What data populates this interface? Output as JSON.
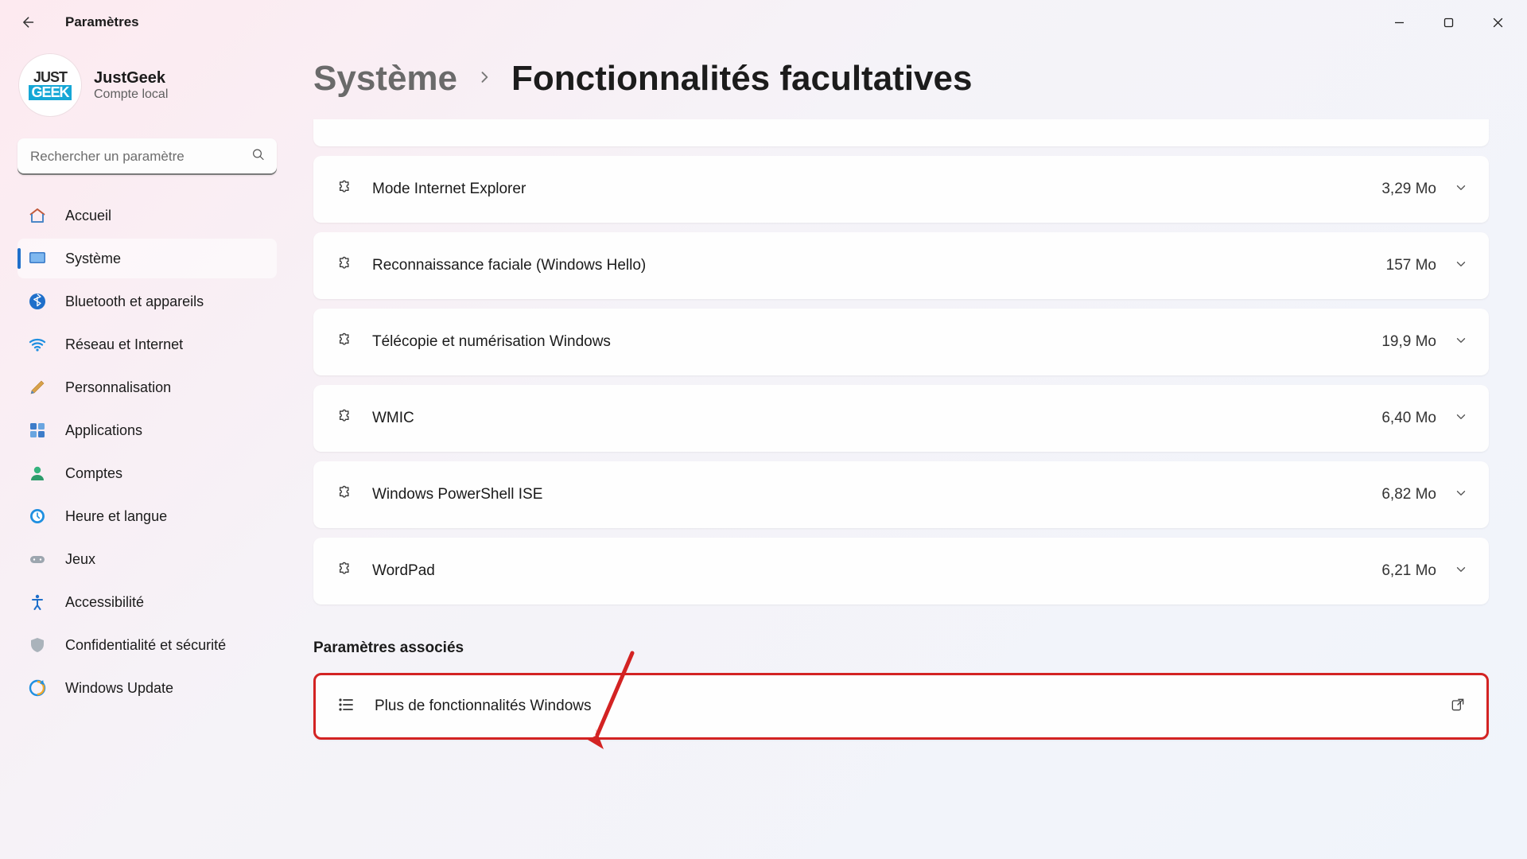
{
  "app_title": "Paramètres",
  "account": {
    "name": "JustGeek",
    "subtitle": "Compte local",
    "avatar_line1": "JUST",
    "avatar_line2": "GEEK"
  },
  "search": {
    "placeholder": "Rechercher un paramètre"
  },
  "sidebar": {
    "items": [
      {
        "key": "home",
        "label": "Accueil"
      },
      {
        "key": "system",
        "label": "Système"
      },
      {
        "key": "bluetooth",
        "label": "Bluetooth et appareils"
      },
      {
        "key": "network",
        "label": "Réseau et Internet"
      },
      {
        "key": "personalization",
        "label": "Personnalisation"
      },
      {
        "key": "apps",
        "label": "Applications"
      },
      {
        "key": "accounts",
        "label": "Comptes"
      },
      {
        "key": "time",
        "label": "Heure et langue"
      },
      {
        "key": "gaming",
        "label": "Jeux"
      },
      {
        "key": "accessibility",
        "label": "Accessibilité"
      },
      {
        "key": "privacy",
        "label": "Confidentialité et sécurité"
      },
      {
        "key": "update",
        "label": "Windows Update"
      }
    ]
  },
  "breadcrumb": {
    "parent": "Système",
    "current": "Fonctionnalités facultatives"
  },
  "features": [
    {
      "label": "Mode Internet Explorer",
      "size": "3,29 Mo"
    },
    {
      "label": "Reconnaissance faciale (Windows Hello)",
      "size": "157 Mo"
    },
    {
      "label": "Télécopie et numérisation Windows",
      "size": "19,9 Mo"
    },
    {
      "label": "WMIC",
      "size": "6,40 Mo"
    },
    {
      "label": "Windows PowerShell ISE",
      "size": "6,82 Mo"
    },
    {
      "label": "WordPad",
      "size": "6,21 Mo"
    }
  ],
  "related": {
    "heading": "Paramètres associés",
    "item_label": "Plus de fonctionnalités Windows"
  },
  "colors": {
    "accent": "#1f6fca",
    "highlight": "#d32323"
  }
}
